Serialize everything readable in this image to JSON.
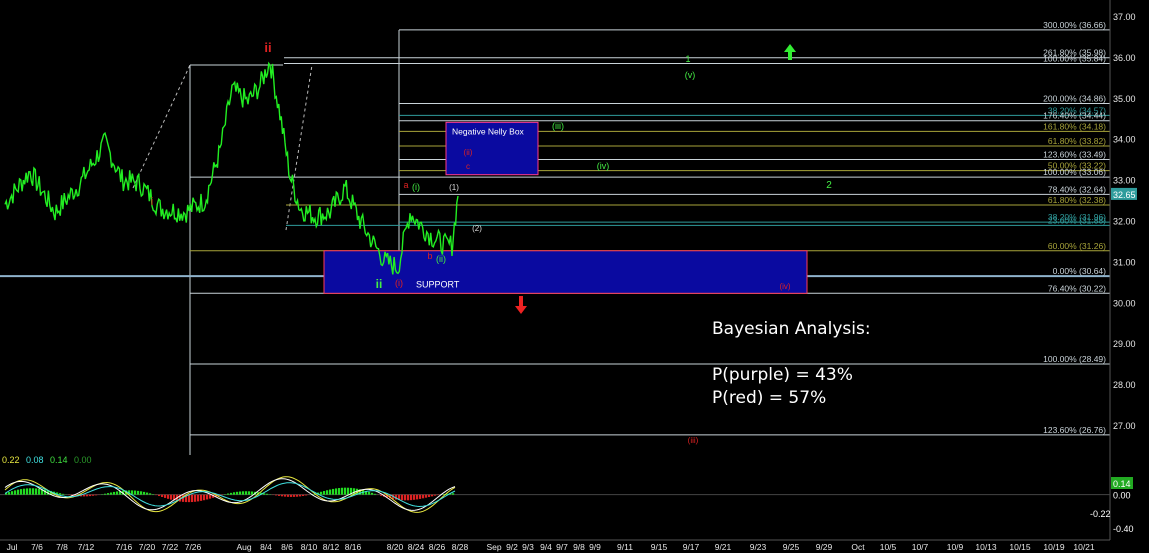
{
  "colors": {
    "background": "#000000",
    "price_line": "#22ee22",
    "fib_level_white": "#c9d3d9",
    "fib_level_olive": "#a8a43a",
    "fib_level_teal": "#2f9c9c",
    "support_box": "#0a0aa0",
    "support_box_border": "#ff3a5a",
    "nelly_box_border": "#ff3a8a",
    "wave_red": "#dd2222",
    "wave_green": "#44ee44",
    "wave_white": "#dddddd",
    "axis_text": "#e6e6e6",
    "last_price_tag": "#2f9c9c",
    "rsi_tag": "#22aa22",
    "horizontal_line": "#8fb3cc"
  },
  "chart_data": {
    "type": "line",
    "title": "",
    "y_axis": {
      "range": [
        26.3,
        37.05
      ],
      "ticks": [
        "37.00",
        "36.00",
        "35.00",
        "34.00",
        "33.00",
        "32.00",
        "31.00",
        "30.00",
        "29.00",
        "28.00",
        "27.00"
      ],
      "tick_values": [
        37,
        36,
        35,
        34,
        33,
        32,
        31,
        30,
        29,
        28,
        27
      ]
    },
    "x_axis": {
      "tick_labels": [
        "Jul",
        "7/6",
        "7/8",
        "7/12",
        "7/16",
        "7/20",
        "7/22",
        "7/26",
        "Aug",
        "8/4",
        "8/6",
        "8/10",
        "8/12",
        "8/16",
        "8/20",
        "8/24",
        "8/26",
        "8/28",
        "Sep",
        "9/2",
        "9/3",
        "9/4",
        "9/7",
        "9/8",
        "9/9",
        "9/11",
        "9/15",
        "9/17",
        "9/21",
        "9/23",
        "9/25",
        "9/29",
        "Oct",
        "10/5",
        "10/7",
        "10/9",
        "10/13",
        "10/15",
        "10/19",
        "10/21"
      ]
    },
    "last_price": "32.65",
    "fib_levels": [
      {
        "label": "300.00% (36.66)",
        "value": 36.66,
        "style": "white"
      },
      {
        "label": "261.80% (35.98)",
        "value": 35.98,
        "style": "white"
      },
      {
        "label": "100.00% (35.84)",
        "value": 35.84,
        "style": "white"
      },
      {
        "label": "200.00% (34.86)",
        "value": 34.86,
        "style": "white"
      },
      {
        "label": "38.20% (34.57)",
        "value": 34.57,
        "style": "teal"
      },
      {
        "label": "176.40% (34.44)",
        "value": 34.44,
        "style": "white"
      },
      {
        "label": "161.80% (34.18)",
        "value": 34.18,
        "style": "olive"
      },
      {
        "label": "61.80% (33.82)",
        "value": 33.82,
        "style": "olive"
      },
      {
        "label": "123.60% (33.49)",
        "value": 33.49,
        "style": "white"
      },
      {
        "label": "50.00% (33.22)",
        "value": 33.22,
        "style": "olive"
      },
      {
        "label": "100.00% (33.06)",
        "value": 33.06,
        "style": "white"
      },
      {
        "label": "78.40% (32.64)",
        "value": 32.64,
        "style": "white"
      },
      {
        "label": "61.80% (32.38)",
        "value": 32.38,
        "style": "olive"
      },
      {
        "label": "38.20% (31.96)",
        "value": 31.96,
        "style": "teal"
      },
      {
        "label": "23.60% (31.88)",
        "value": 31.88,
        "style": "teal"
      },
      {
        "label": "60.00% (31.26)",
        "value": 31.26,
        "style": "olive"
      },
      {
        "label": "0.00% (30.64)",
        "value": 30.64,
        "style": "white"
      },
      {
        "label": "76.40% (30.22)",
        "value": 30.22,
        "style": "white"
      },
      {
        "label": "100.00% (28.49)",
        "value": 28.49,
        "style": "white"
      },
      {
        "label": "123.60% (26.76)",
        "value": 26.76,
        "style": "white"
      }
    ],
    "boxes": [
      {
        "name": "support-box",
        "label": "SUPPORT",
        "y_top": 31.26,
        "y_bottom": 30.22
      },
      {
        "name": "negative-nelly-box",
        "label": "Negative Nelly Box",
        "y_top": 34.4,
        "y_bottom": 33.12
      }
    ],
    "wave_labels": [
      {
        "text": "ii",
        "color": "red"
      },
      {
        "text": "i",
        "color": "red"
      },
      {
        "text": "ii",
        "color": "green"
      },
      {
        "text": "(i)",
        "color": "red"
      },
      {
        "text": "a",
        "color": "red"
      },
      {
        "text": "(i)",
        "color": "green"
      },
      {
        "text": "b",
        "color": "red"
      },
      {
        "text": "(ii)",
        "color": "green"
      },
      {
        "text": "(1)",
        "color": "white"
      },
      {
        "text": "(2)",
        "color": "white"
      },
      {
        "text": "(iii)",
        "color": "green"
      },
      {
        "text": "(ii)",
        "color": "red"
      },
      {
        "text": "c",
        "color": "red"
      },
      {
        "text": "(iv)",
        "color": "green"
      },
      {
        "text": "2",
        "color": "green"
      },
      {
        "text": "1",
        "color": "green"
      },
      {
        "text": "(v)",
        "color": "green"
      },
      {
        "text": "(iv)",
        "color": "red"
      },
      {
        "text": "(iii)",
        "color": "red"
      }
    ],
    "oscillator": {
      "header_values": [
        {
          "text": "0.22",
          "color": "#e8e840"
        },
        {
          "text": "0.08",
          "color": "#40e0e0"
        },
        {
          "text": "0.14",
          "color": "#40e040"
        },
        {
          "text": "0.00",
          "color": "#2a9a2a"
        }
      ],
      "axis_labels": [
        "0.14",
        "0.00",
        "-0.22",
        "-0.40"
      ],
      "axis_values": [
        0.14,
        0.0,
        -0.22,
        -0.4
      ],
      "range": [
        -0.46,
        0.38
      ]
    }
  },
  "analysis": {
    "heading": "Bayesian Analysis:",
    "line1": "P(purple) = 43%",
    "line2": "P(red) = 57%"
  }
}
